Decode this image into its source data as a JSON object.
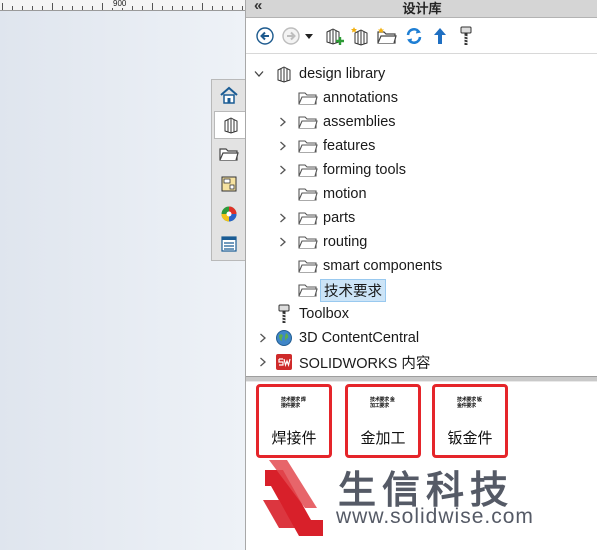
{
  "ruler": {
    "label": "900"
  },
  "pane": {
    "title": "设计库",
    "collapse_glyph": "«"
  },
  "toolbar": {
    "icons": [
      "back-icon",
      "forward-icon",
      "dropdown-arrow-icon",
      "add-to-library-icon",
      "add-file-location-icon",
      "create-new-folder-icon",
      "refresh-icon",
      "up-one-level-icon",
      "toolbox-settings-icon"
    ]
  },
  "tree": {
    "design_library": "design library",
    "children": [
      "annotations",
      "assemblies",
      "features",
      "forming tools",
      "motion",
      "parts",
      "routing",
      "smart components",
      "技术要求"
    ],
    "toolbox": "Toolbox",
    "content_central": "3D ContentCentral",
    "solidworks_content": "SOLIDWORKS 内容"
  },
  "items": [
    {
      "caption": "焊接件",
      "preview_text": "技术要求 焊接件要求"
    },
    {
      "caption": "金加工",
      "preview_text": "技术要求 金加工要求"
    },
    {
      "caption": "钣金件",
      "preview_text": "技术要求 钣金件要求"
    }
  ],
  "watermark": {
    "cn": "生信科技",
    "url": "www.solidwise.com"
  },
  "colors": {
    "highlight_border": "#e5252a",
    "selection": "#cce4f7",
    "watermark": "#555a66",
    "logo_red": "#d8202a"
  }
}
